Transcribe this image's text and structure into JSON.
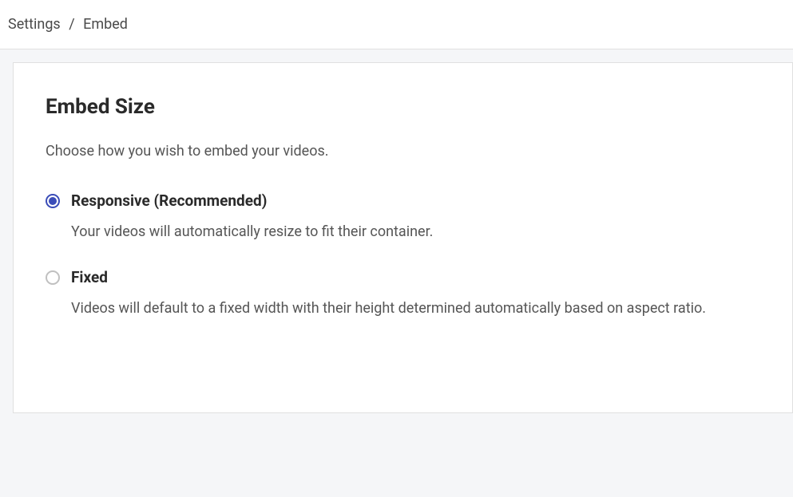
{
  "breadcrumb": {
    "parent": "Settings",
    "separator": "/",
    "current": "Embed"
  },
  "card": {
    "title": "Embed Size",
    "description": "Choose how you wish to embed your videos.",
    "options": [
      {
        "label": "Responsive (Recommended)",
        "description": "Your videos will automatically resize to fit their container.",
        "selected": true
      },
      {
        "label": "Fixed",
        "description": "Videos will default to a fixed width with their height determined automatically based on aspect ratio.",
        "selected": false
      }
    ]
  }
}
